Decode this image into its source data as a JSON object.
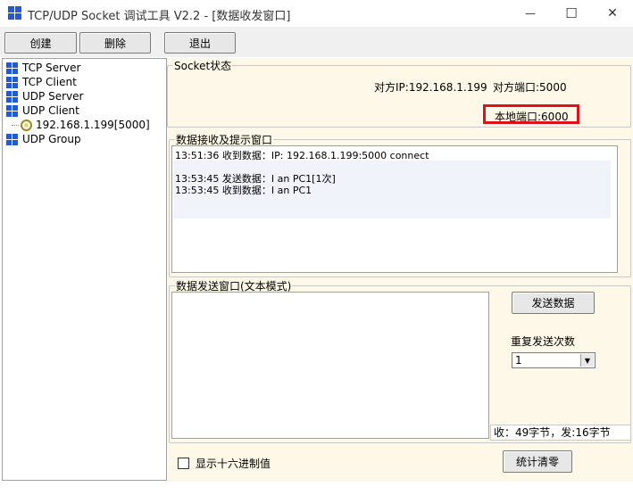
{
  "window": {
    "title": "TCP/UDP Socket 调试工具 V2.2 - [数据收发窗口]",
    "minimize_glyph": "—",
    "maximize_glyph": "☐",
    "close_glyph": "✕"
  },
  "toolbar": {
    "create_label": "创建",
    "delete_label": "删除",
    "exit_label": "退出"
  },
  "tree": {
    "items": [
      {
        "label": "TCP Server"
      },
      {
        "label": "TCP Client"
      },
      {
        "label": "UDP Server"
      },
      {
        "label": "UDP Client"
      },
      {
        "label": "192.168.1.199[5000]"
      },
      {
        "label": "UDP Group"
      }
    ]
  },
  "socket_status": {
    "group_label": "Socket状态",
    "peer_ip": "对方IP:192.168.1.199",
    "peer_port": "对方端口:5000",
    "local_port": "本地端口:6000"
  },
  "receive": {
    "group_label": "数据接收及提示窗口",
    "lines": [
      "13:51:36 收到数据：IP: 192.168.1.199:5000 connect",
      "",
      "13:53:45 发送数据：I an PC1[1次]",
      "13:53:45 收到数据：I an PC1"
    ]
  },
  "send": {
    "group_label": "数据发送窗口(文本模式)",
    "send_button_label": "发送数据",
    "repeat_label": "重复发送次数",
    "repeat_value": "1",
    "stats_text": "收：49字节，发:16字节",
    "hex_checkbox_label": "显示十六进制值",
    "clear_stats_label": "统计清零"
  },
  "colors": {
    "highlight_border": "#e0101c",
    "panel_bg": "#fdf8e8",
    "icon_blue": "#1f5bd6"
  }
}
